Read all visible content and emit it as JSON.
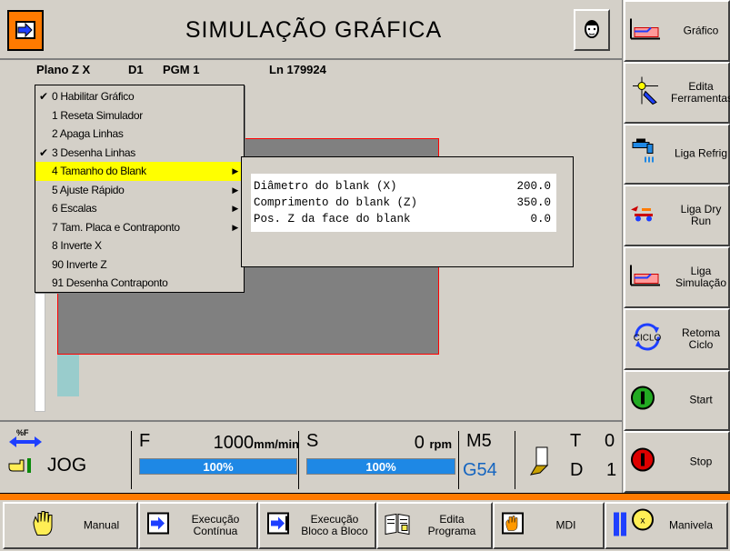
{
  "title": "SIMULAÇÃO GRÁFICA",
  "info": {
    "plane": "Plano Z X",
    "tool": "D1",
    "program": "PGM 1",
    "line": "Ln 179924"
  },
  "menu": [
    {
      "label": "0 Habilitar Gráfico",
      "checked": true,
      "submenu": false
    },
    {
      "label": "1 Reseta Simulador",
      "checked": false,
      "submenu": false
    },
    {
      "label": "2 Apaga Linhas",
      "checked": false,
      "submenu": false
    },
    {
      "label": "3 Desenha Linhas",
      "checked": true,
      "submenu": false
    },
    {
      "label": "4 Tamanho do Blank",
      "checked": false,
      "submenu": true,
      "selected": true
    },
    {
      "label": "5 Ajuste Rápido",
      "checked": false,
      "submenu": true
    },
    {
      "label": "6 Escalas",
      "checked": false,
      "submenu": true
    },
    {
      "label": "7 Tam. Placa e Contraponto",
      "checked": false,
      "submenu": true
    },
    {
      "label": "8 Inverte X",
      "checked": false,
      "submenu": false
    },
    {
      "label": "90 Inverte Z",
      "checked": false,
      "submenu": false
    },
    {
      "label": "91 Desenha Contraponto",
      "checked": false,
      "submenu": false
    }
  ],
  "submenu": {
    "rows": [
      {
        "label": "Diâmetro do blank (X)",
        "value": "200.0"
      },
      {
        "label": "Comprimento do blank (Z)",
        "value": "350.0"
      },
      {
        "label": "Pos. Z da face do blank",
        "value": "0.0"
      }
    ]
  },
  "status": {
    "mode": "JOG",
    "feed_symbol": "%F",
    "f_label": "F",
    "f_value": "1000",
    "f_unit": "mm/min",
    "f_override": "100%",
    "f_override_fraction": 1.0,
    "s_label": "S",
    "s_value": "0",
    "s_unit": "rpm",
    "s_override": "100%",
    "s_override_fraction": 1.0,
    "m_code": "M5",
    "g_code": "G54",
    "t_label": "T",
    "t_value": "0",
    "d_label": "D",
    "d_value": "1"
  },
  "right_softkeys": [
    {
      "label": "Gráfico",
      "icon": "graphic-icon"
    },
    {
      "label": "Edita Ferramentas",
      "icon": "tool-edit-icon"
    },
    {
      "label": "Liga Refrig",
      "icon": "coolant-icon"
    },
    {
      "label": "Liga Dry Run",
      "icon": "dry-run-icon"
    },
    {
      "label": "Liga Simulação",
      "icon": "simulation-icon"
    },
    {
      "label": "Retoma Ciclo",
      "icon": "cycle-icon",
      "icon_text": "CICLO"
    },
    {
      "label": "Start",
      "icon": "start-icon"
    },
    {
      "label": "Stop",
      "icon": "stop-icon"
    }
  ],
  "bottom_softkeys": [
    {
      "label": "Manual",
      "icon": "hand-icon"
    },
    {
      "label": "Execução Contínua",
      "icon": "continuous-exec-icon"
    },
    {
      "label": "Execução Bloco a Bloco",
      "icon": "block-exec-icon"
    },
    {
      "label": "Edita Programa",
      "icon": "edit-program-icon"
    },
    {
      "label": "MDI",
      "icon": "mdi-icon"
    },
    {
      "label": "Manivela",
      "icon": "handwheel-icon"
    }
  ],
  "colors": {
    "accent": "#ff7a00",
    "menu_highlight": "#ffff00",
    "blank": "#808080",
    "blank_outline": "#ff0000",
    "progress": "#1e88e5",
    "g_code": "#1565c0",
    "chuck": "#99cccc"
  }
}
